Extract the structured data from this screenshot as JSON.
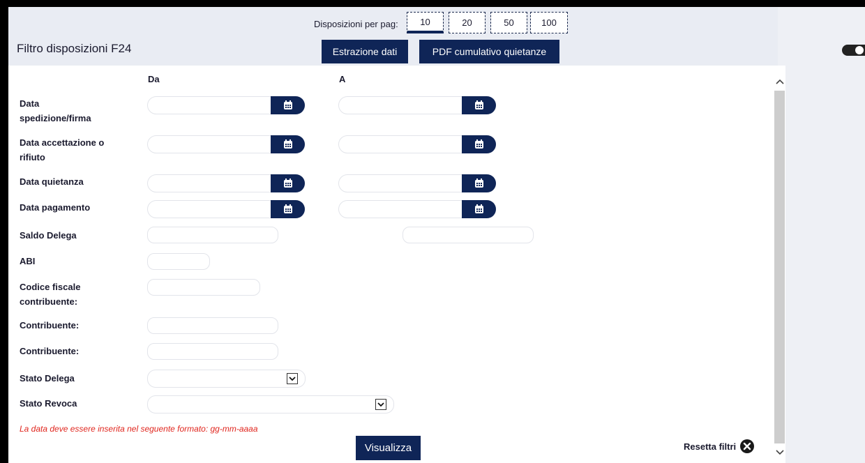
{
  "header": {
    "title": "Filtro disposizioni F24",
    "per_page_label": "Disposizioni per pag:",
    "per_page_options": [
      "10",
      "20",
      "50",
      "100"
    ],
    "per_page_selected": "10",
    "extract_button": "Estrazione dati",
    "pdf_button": "PDF cumulativo quietanze"
  },
  "form": {
    "col_from": "Da",
    "col_to": "A",
    "labels": {
      "data_spedizione": "Data spedizione/firma",
      "data_accettazione": "Data accettazione o rifiuto",
      "data_quietanza": "Data quietanza",
      "data_pagamento": "Data pagamento",
      "saldo_delega": "Saldo Delega",
      "abi": "ABI",
      "codice_fiscale": "Codice fiscale contribuente:",
      "contribuente_1": "Contribuente:",
      "contribuente_2": "Contribuente:",
      "stato_delega": "Stato Delega",
      "stato_revoca": "Stato Revoca"
    },
    "hint": "La data deve essere inserita nel seguente formato: gg-mm-aaaa",
    "submit": "Visualizza",
    "reset": "Resetta filtri"
  },
  "colors": {
    "accent": "#0f2557",
    "header_bg": "#e9ecf3",
    "hint_red": "#e0261e"
  }
}
